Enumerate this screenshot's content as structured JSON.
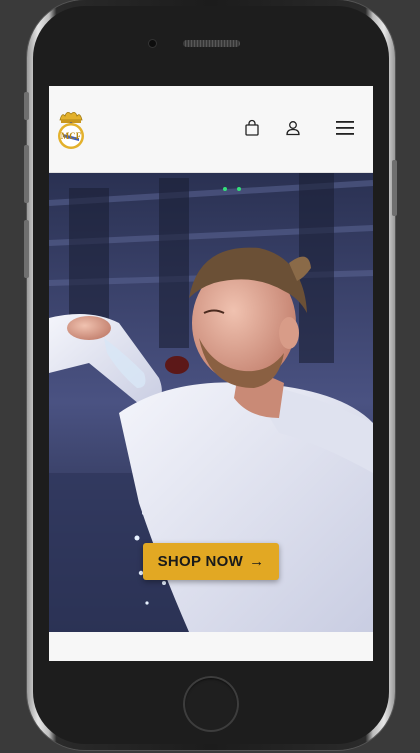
{
  "device": {
    "frame": "smartphone"
  },
  "header": {
    "logo_icon": "club-crest-logo",
    "cart_icon": "shopping-bag-icon",
    "account_icon": "user-icon",
    "menu_icon": "hamburger-menu-icon"
  },
  "hero": {
    "image": "footballer-in-white-kit-splashing-water-in-stadium",
    "cta_label": "SHOP NOW",
    "cta_arrow": "→",
    "cta_color": "#e2a823"
  },
  "colors": {
    "screen_bg": "#f7f7f7",
    "page_bg": "#3a3a3a",
    "accent": "#e2a823"
  }
}
